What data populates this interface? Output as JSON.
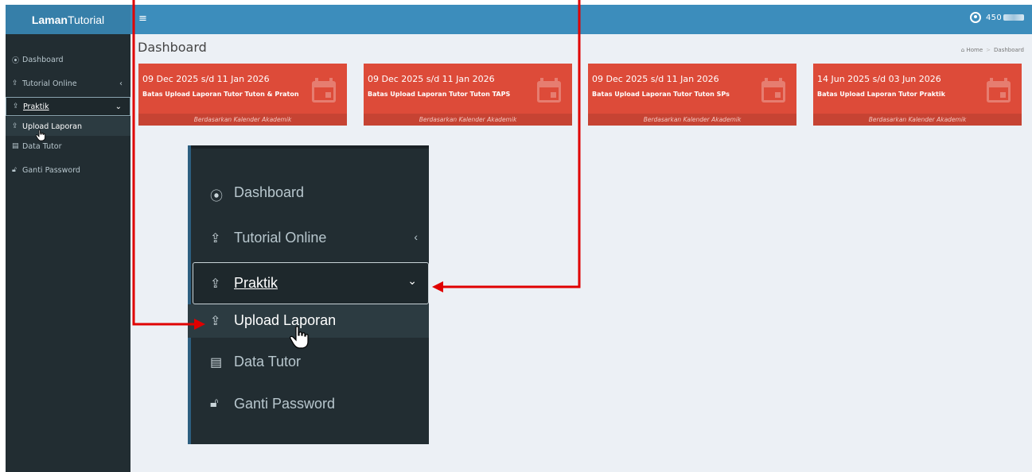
{
  "app": {
    "logo_bold": "Laman",
    "logo_light": "Tutorial"
  },
  "topbar": {
    "hamburger": "≡",
    "user_visible": "450"
  },
  "sidebar": {
    "items": [
      {
        "label": "Dashboard",
        "icon": "dashboard-icon",
        "glyph": "⦿"
      },
      {
        "label": "Tutorial Online",
        "icon": "upload-icon",
        "glyph": "⇪",
        "chevron": "‹"
      },
      {
        "label": "Praktik",
        "icon": "upload-icon",
        "glyph": "⇪",
        "chevron": "⌄"
      },
      {
        "label": "Upload Laporan",
        "icon": "upload-icon",
        "glyph": "⇪"
      },
      {
        "label": "Data Tutor",
        "icon": "id-card-icon",
        "glyph": "▤"
      },
      {
        "label": "Ganti Password",
        "icon": "lock-icon",
        "glyph": "🔓︎"
      }
    ]
  },
  "page": {
    "title": "Dashboard",
    "breadcrumb": {
      "home": "Home",
      "sep": ">",
      "current": "Dashboard"
    }
  },
  "cards": [
    {
      "date": "09 Dec 2025 s/d 11 Jan 2026",
      "desc": "Batas Upload Laporan Tutor Tuton & Praton",
      "footer": "Berdasarkan Kalender Akademik"
    },
    {
      "date": "09 Dec 2025 s/d 11 Jan 2026",
      "desc": "Batas Upload Laporan Tutor Tuton TAPS",
      "footer": "Berdasarkan Kalender Akademik"
    },
    {
      "date": "09 Dec 2025 s/d 11 Jan 2026",
      "desc": "Batas Upload Laporan Tutor Tuton SPs",
      "footer": "Berdasarkan Kalender Akademik"
    },
    {
      "date": "14 Jun 2025 s/d 03 Jun 2026",
      "desc": "Batas Upload Laporan Tutor Praktik",
      "footer": "Berdasarkan Kalender Akademik"
    }
  ],
  "colors": {
    "header": "#3c8dbc",
    "sidebar": "#222d32",
    "card": "#dd4b39",
    "arrow": "#e00000",
    "content_bg": "#ecf0f5"
  }
}
